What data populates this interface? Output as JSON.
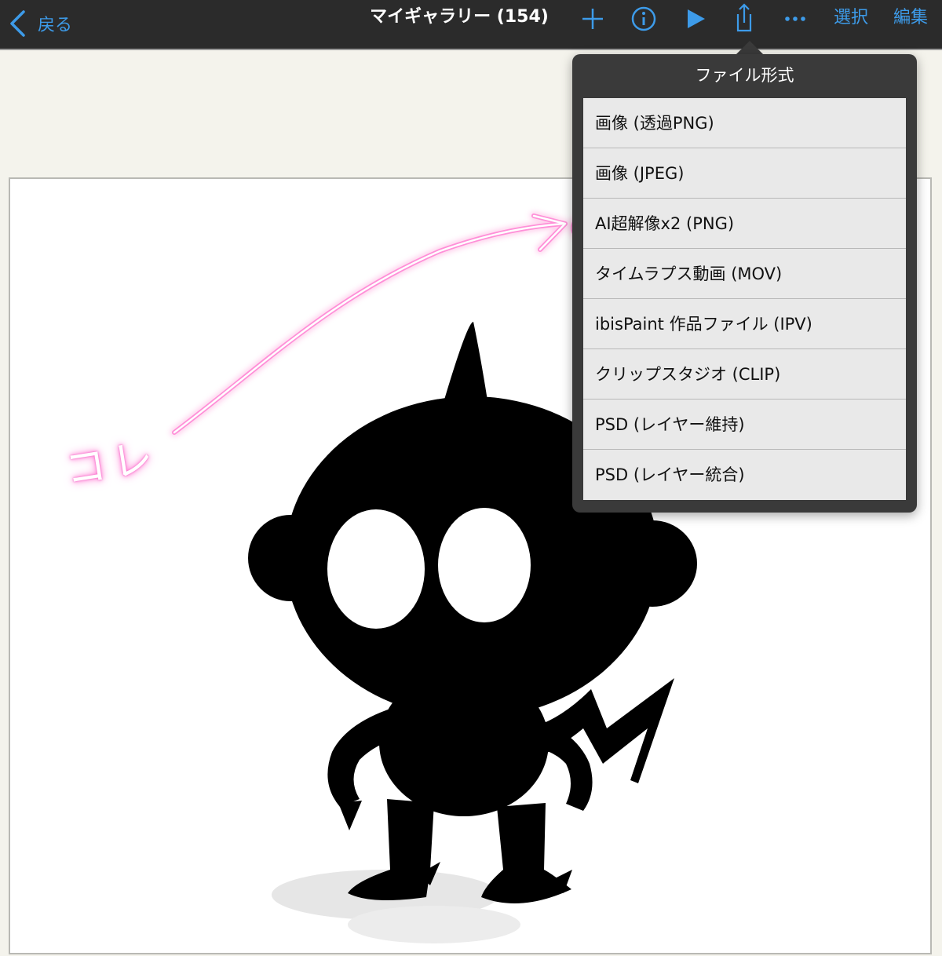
{
  "nav": {
    "back_label": "戻る",
    "title": "マイギャラリー (154)",
    "select_label": "選択",
    "edit_label": "編集",
    "icons": [
      "chevron-left-icon",
      "plus-icon",
      "info-icon",
      "play-icon",
      "share-icon",
      "more-icon"
    ]
  },
  "popover": {
    "title": "ファイル形式",
    "items": [
      "画像 (透過PNG)",
      "画像 (JPEG)",
      "AI超解像x2 (PNG)",
      "タイムラプス動画 (MOV)",
      "ibisPaint 作品ファイル (IPV)",
      "クリップスタジオ (CLIP)",
      "PSD (レイヤー維持)",
      "PSD (レイヤー統合)"
    ]
  },
  "annotation": {
    "label": "コレ",
    "color": "#ff6fcf"
  },
  "colors": {
    "accent": "#3d9be9",
    "topbar": "#2b2b2b",
    "background": "#f4f3ec"
  }
}
